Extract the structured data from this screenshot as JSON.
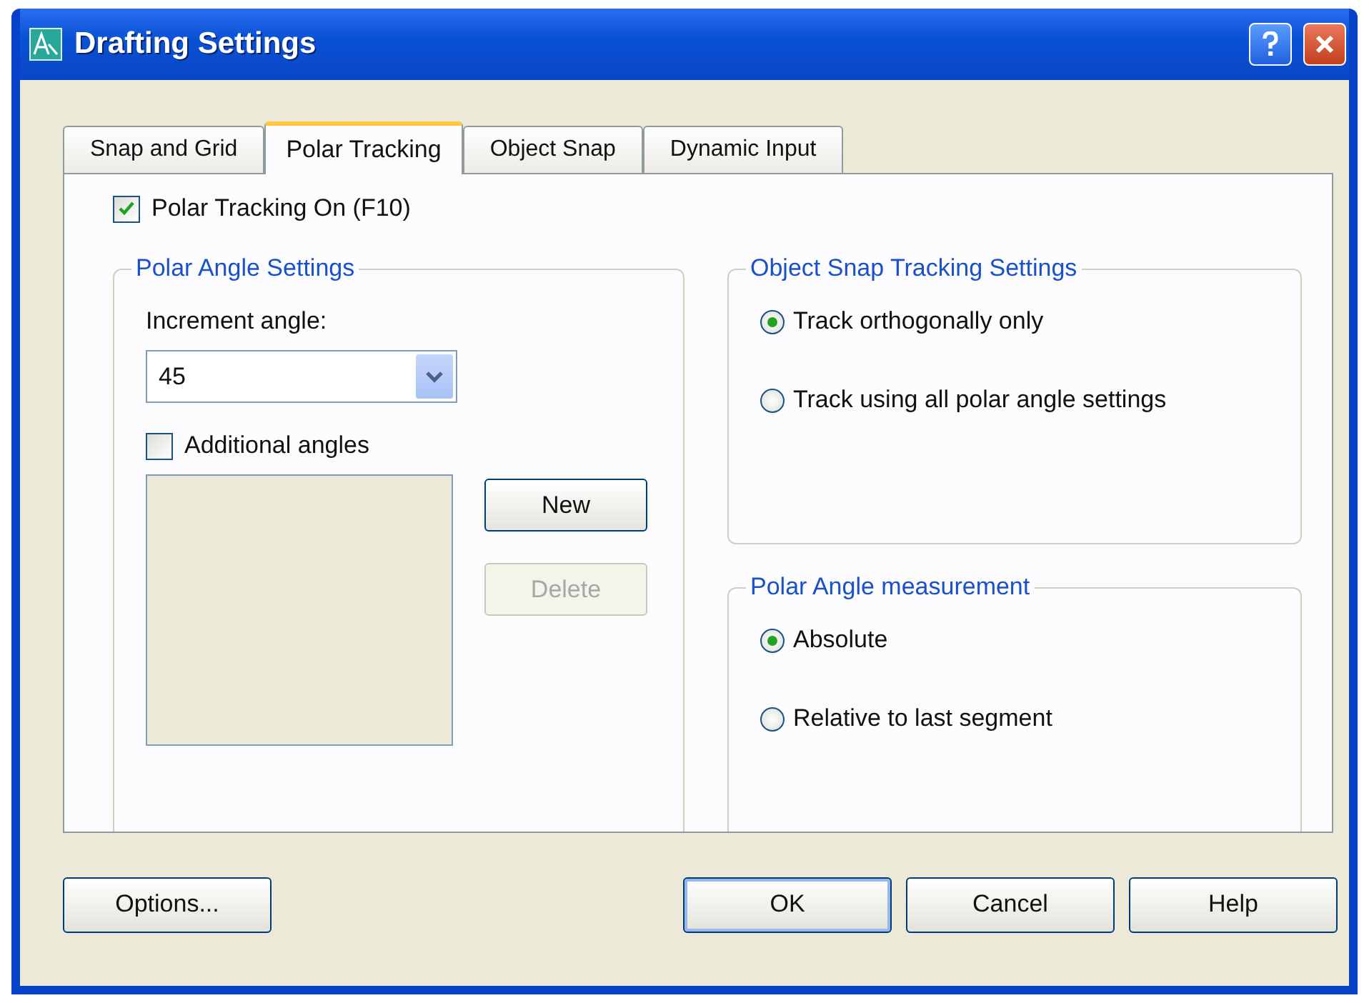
{
  "window": {
    "title": "Drafting Settings"
  },
  "tabs": [
    {
      "label": "Snap and Grid",
      "selected": false
    },
    {
      "label": "Polar Tracking",
      "selected": true
    },
    {
      "label": "Object Snap",
      "selected": false
    },
    {
      "label": "Dynamic Input",
      "selected": false
    }
  ],
  "polar_tracking_on": {
    "label": "Polar Tracking On (F10)",
    "checked": true
  },
  "polar_angle_settings": {
    "title": "Polar Angle Settings",
    "increment_label": "Increment angle:",
    "increment_value": "45",
    "additional_angles": {
      "label": "Additional angles",
      "checked": false
    },
    "buttons": [
      {
        "label": "New",
        "disabled": false
      },
      {
        "label": "Delete",
        "disabled": true
      }
    ]
  },
  "object_snap_tracking": {
    "title": "Object Snap Tracking Settings",
    "options": [
      {
        "label": "Track orthogonally only",
        "selected": true
      },
      {
        "label": "Track using all polar angle settings",
        "selected": false
      }
    ]
  },
  "polar_angle_measurement": {
    "title": "Polar Angle measurement",
    "options": [
      {
        "label": "Absolute",
        "selected": true
      },
      {
        "label": "Relative to last segment",
        "selected": false
      }
    ]
  },
  "buttons": [
    {
      "label": "Options...",
      "default": false
    },
    {
      "label": "OK",
      "default": true
    },
    {
      "label": "Cancel",
      "default": false
    },
    {
      "label": "Help",
      "default": false
    }
  ]
}
